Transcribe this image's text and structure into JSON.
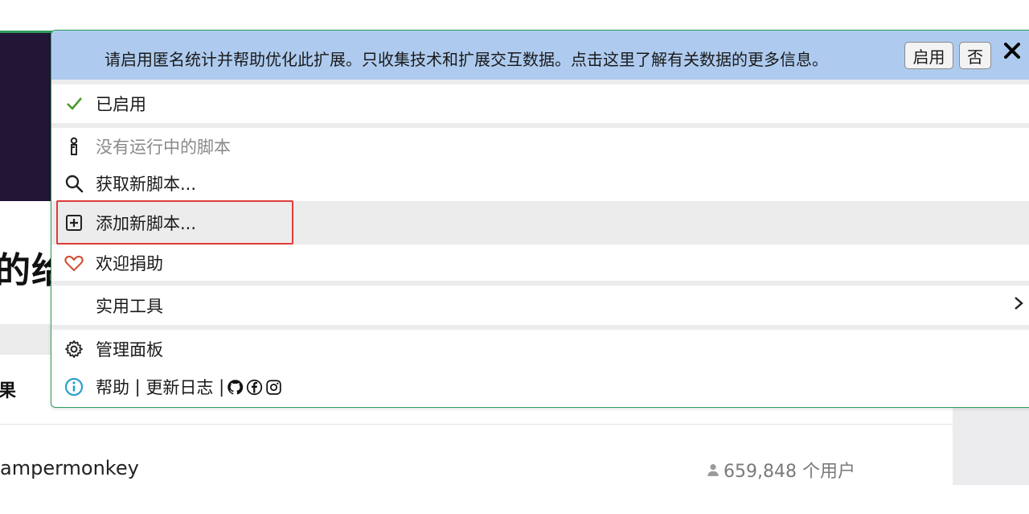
{
  "background": {
    "heading_fragment": "的给",
    "subheading_fragment": "果",
    "script_name_fragment": "ampermonkey",
    "users": "659,848 个用户"
  },
  "popup": {
    "banner": {
      "text": "请启用匿名统计并帮助优化此扩展。只收集技术和扩展交互数据。点击这里了解有关数据的更多信息。",
      "enable_label": "启用",
      "no_label": "否",
      "close_label": "✕"
    },
    "items": {
      "enabled": "已启用",
      "no_scripts": "没有运行中的脚本",
      "get_new_script": "获取新脚本...",
      "add_new_script": "添加新脚本...",
      "donate": "欢迎捐助",
      "utilities": "实用工具",
      "dashboard": "管理面板",
      "help": "帮助",
      "divider1": " | ",
      "changelog": "更新日志",
      "divider2": " |"
    },
    "colors": {
      "banner_bg": "#aecbef",
      "check": "#4a9a2a",
      "heart": "#d2553b",
      "info": "#2a9fc9",
      "highlight_box": "#e03b3b"
    },
    "icons": {
      "enabled": "check-icon",
      "no_scripts": "info-pin-icon",
      "get_new_script": "search-icon",
      "add_new_script": "plus-square-icon",
      "donate": "heart-icon",
      "dashboard": "gear-icon",
      "help": "info-circle-icon"
    }
  }
}
